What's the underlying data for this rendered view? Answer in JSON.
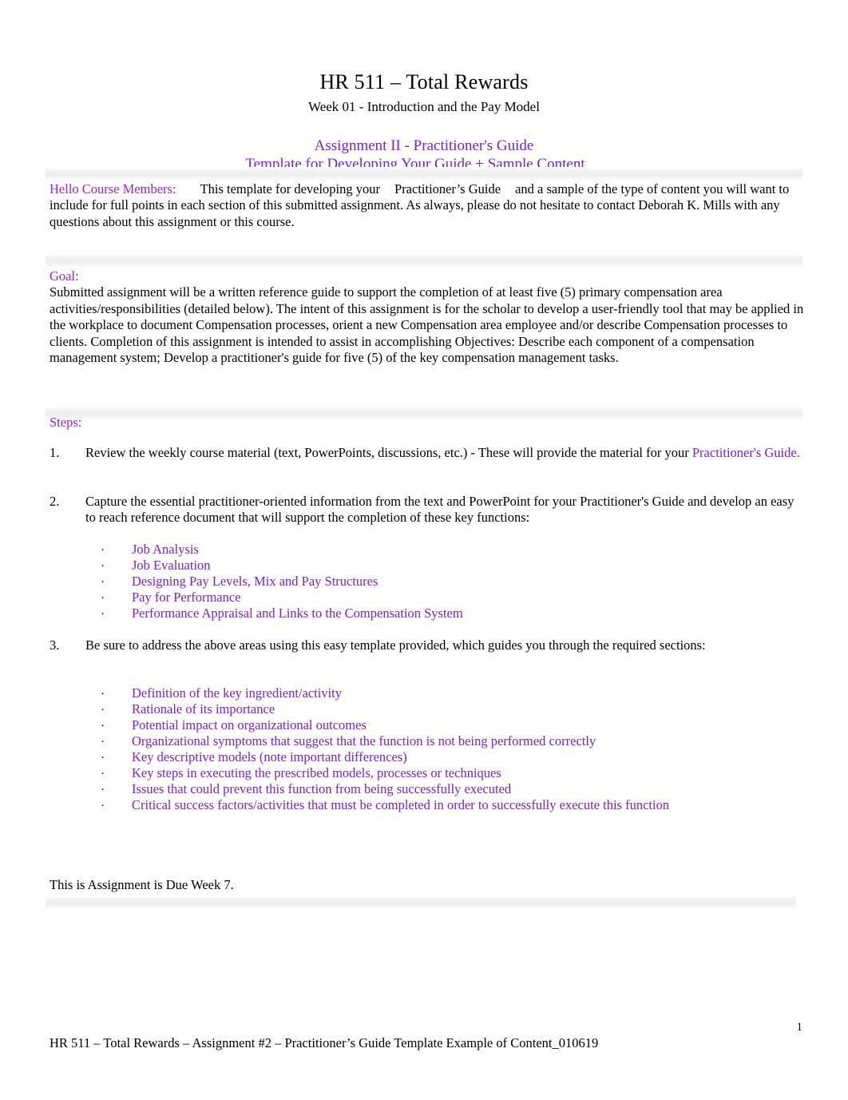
{
  "document": {
    "title": "HR 511 – Total Rewards",
    "subtitle": "Week 01 - Introduction and the Pay Model",
    "assignment_title": "Assignment II - Practitioner's Guide",
    "assignment_subtitle": "Template for Developing Your Guide + Sample Content"
  },
  "greeting": {
    "label": "Hello Course Members:",
    "text_part1": "This template for developing your",
    "emphasis": "Practitioner’s Guide",
    "text_part2": "and a sample of the type of content you will want to include for full points in each section of this submitted assignment. As always, please do not hesitate to contact Deborah K. Mills with any questions about this assignment or this course."
  },
  "goal": {
    "label": "Goal:",
    "text": "Submitted assignment will be a written reference guide to support the completion of at least five (5) primary compensation area activities/responsibilities (detailed below). The intent of this assignment is for the scholar to develop a user-friendly tool that may be applied in the workplace to document Compensation processes, orient a new Compensation area employee and/or describe Compensation processes to clients. Completion of this assignment is intended to assist in accomplishing Objectives: Describe each component of a compensation management system; Develop a practitioner's guide for five (5) of the key compensation management tasks."
  },
  "steps_section": {
    "label": "Steps:",
    "step1": {
      "number": "1.",
      "text": "Review the weekly course material (text, PowerPoints, discussions, etc.) - These will provide the material for your",
      "highlight": "Practitioner's Guide."
    },
    "step2": {
      "number": "2.",
      "text": "Capture the essential practitioner-oriented information from the text and PowerPoint for your Practitioner's Guide and develop an easy to reach reference document that will support the completion of these key functions:"
    },
    "step3": {
      "number": "3.",
      "text": "Be sure to address the above areas using this easy template provided, which guides you through the required sections:"
    }
  },
  "bullet_marker": "·",
  "key_functions": [
    "Job Analysis",
    "Job Evaluation",
    "Designing Pay Levels, Mix and Pay Structures",
    "Pay for Performance",
    "Performance Appraisal and Links to the Compensation System"
  ],
  "required_sections": [
    "Definition of the key ingredient/activity",
    "Rationale of its importance",
    "Potential impact on organizational outcomes",
    "Organizational symptoms that suggest that the function is not being performed correctly",
    "Key descriptive models (note important differences)",
    "Key steps in executing the prescribed models, processes or techniques",
    "Issues that could prevent this function from being successfully executed",
    "Critical success factors/activities that must be completed in order to successfully execute this function"
  ],
  "due_note": "This is Assignment is Due Week 7.",
  "footer": {
    "text": "HR 511 – Total Rewards – Assignment #2 – Practitioner’s Guide Template Example of Content_010619",
    "page_number": "1"
  },
  "colors": {
    "heading_purple": "#7722cc",
    "label_purple": "#9922cc",
    "body_black": "#000000",
    "band_gray": "#eeeeee"
  }
}
